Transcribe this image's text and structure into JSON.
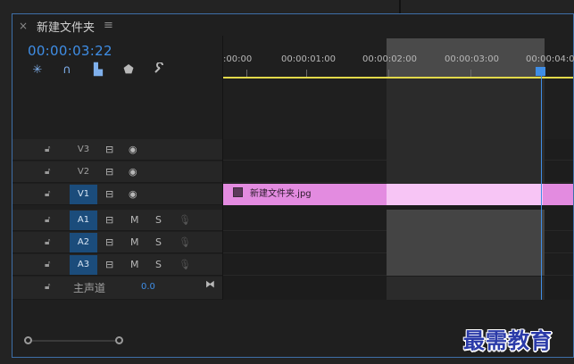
{
  "tab": {
    "close_glyph": "×",
    "title": "新建文件夹",
    "menu_glyph": "≡"
  },
  "timecode": "00:00:03:22",
  "toolbar": [
    {
      "name": "snap-nest-icon",
      "glyph": "✳"
    },
    {
      "name": "magnet-icon",
      "glyph": "∩"
    },
    {
      "name": "linked-selection-icon",
      "glyph": "▙"
    },
    {
      "name": "marker-icon",
      "glyph": "⬟"
    },
    {
      "name": "wrench-icon",
      "glyph": "🔧"
    }
  ],
  "ruler": {
    "labels": [
      ":00:00",
      "00:00:01:00",
      "00:00:02:00",
      "00:00:03:00",
      "00:00:04:00"
    ]
  },
  "tracks": [
    {
      "id": "V3",
      "type": "video",
      "active": false
    },
    {
      "id": "V2",
      "type": "video",
      "active": false
    },
    {
      "id": "V1",
      "type": "video",
      "active": true
    },
    {
      "id": "A1",
      "type": "audio",
      "active": true,
      "m": "M",
      "s": "S"
    },
    {
      "id": "A2",
      "type": "audio",
      "active": true,
      "m": "M",
      "s": "S"
    },
    {
      "id": "A3",
      "type": "audio",
      "active": true,
      "m": "M",
      "s": "S"
    }
  ],
  "master": {
    "label": "主声道",
    "value": "0.0"
  },
  "clip": {
    "name": "新建文件夹.jpg",
    "color": "#e38be0",
    "selected_color": "#f7c5f5"
  },
  "colors": {
    "accent": "#3f8ee6",
    "ruler_line": "#e2d94a",
    "active_track": "#1b4c7b"
  },
  "watermark": "最需教育"
}
